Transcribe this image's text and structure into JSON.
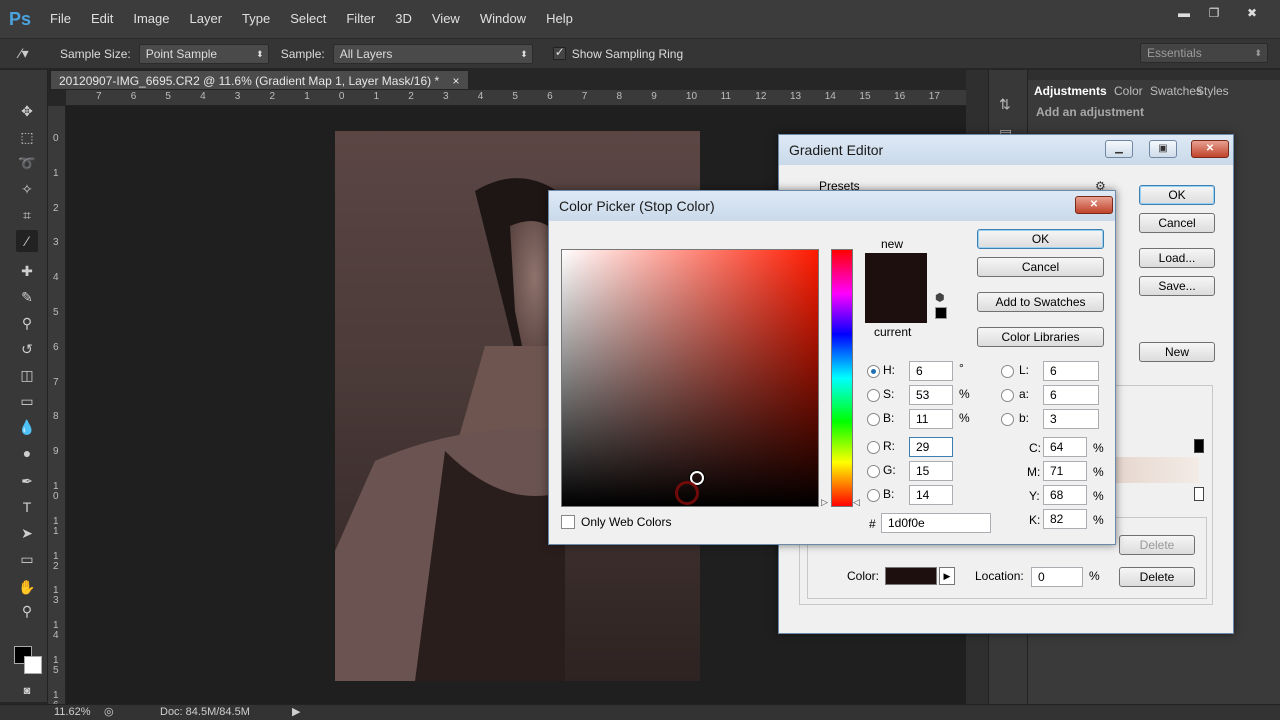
{
  "app": {
    "logo": "Ps"
  },
  "menu": [
    "File",
    "Edit",
    "Image",
    "Layer",
    "Type",
    "Select",
    "Filter",
    "3D",
    "View",
    "Window",
    "Help"
  ],
  "window_controls": {
    "minimize": "▬",
    "restore": "❐",
    "close": "✖"
  },
  "options_bar": {
    "sample_size_label": "Sample Size:",
    "sample_size_value": "Point Sample",
    "sample_label": "Sample:",
    "sample_value": "All Layers",
    "show_ring_label": "Show Sampling Ring",
    "show_ring_checked": true,
    "workspace": "Essentials"
  },
  "document_tab": {
    "title": "20120907-IMG_6695.CR2 @ 11.6% (Gradient Map 1, Layer Mask/16) *",
    "close": "×"
  },
  "ruler": {
    "h_ticks": [
      "7",
      "6",
      "5",
      "4",
      "3",
      "2",
      "1",
      "0",
      "1",
      "2",
      "3",
      "4",
      "5",
      "6",
      "7",
      "8",
      "9",
      "10",
      "11",
      "12",
      "13",
      "14",
      "15",
      "16",
      "17"
    ],
    "v_ticks": [
      "0",
      "1",
      "2",
      "3",
      "4",
      "5",
      "6",
      "7",
      "8",
      "9",
      "1\n0",
      "1\n1",
      "1\n2",
      "1\n3",
      "1\n4",
      "1\n5",
      "1\n6"
    ]
  },
  "status": {
    "zoom": "11.62%",
    "doc": "Doc: 84.5M/84.5M"
  },
  "panels": {
    "tabs": [
      "Adjustments",
      "Color",
      "Swatches",
      "Styles"
    ],
    "subtitle": "Add an adjustment"
  },
  "gradient_editor": {
    "title": "Gradient Editor",
    "presets_label": "Presets",
    "buttons": {
      "ok": "OK",
      "cancel": "Cancel",
      "load": "Load...",
      "save": "Save...",
      "new": "New"
    },
    "stops": {
      "color_label": "Color:",
      "location_label": "Location:",
      "location_value": "0",
      "location_unit": "%",
      "delete": "Delete",
      "delete_disabled": "Delete"
    },
    "stop_color": "#1d0f0e"
  },
  "color_picker": {
    "title": "Color Picker (Stop Color)",
    "new_label": "new",
    "current_label": "current",
    "new_color": "#1d0f0e",
    "current_color": "#1d0f0e",
    "buttons": {
      "ok": "OK",
      "cancel": "Cancel",
      "add_swatches": "Add to Swatches",
      "color_libraries": "Color Libraries"
    },
    "only_web_colors": "Only Web Colors",
    "hsb": {
      "h_label": "H:",
      "h": "6",
      "h_unit": "°",
      "s_label": "S:",
      "s": "53",
      "s_unit": "%",
      "b_label": "B:",
      "b": "11",
      "b_unit": "%"
    },
    "rgb": {
      "r_label": "R:",
      "r": "29",
      "g_label": "G:",
      "g": "15",
      "b_label": "B:",
      "b": "14"
    },
    "lab": {
      "l_label": "L:",
      "l": "6",
      "a_label": "a:",
      "a": "6",
      "b_label": "b:",
      "b": "3"
    },
    "cmyk": {
      "c_label": "C:",
      "c": "64",
      "m_label": "M:",
      "m": "71",
      "y_label": "Y:",
      "y": "68",
      "k_label": "K:",
      "k": "82",
      "unit": "%"
    },
    "hex_label": "#",
    "hex": "1d0f0e",
    "hue_base": "#ff1a00"
  }
}
